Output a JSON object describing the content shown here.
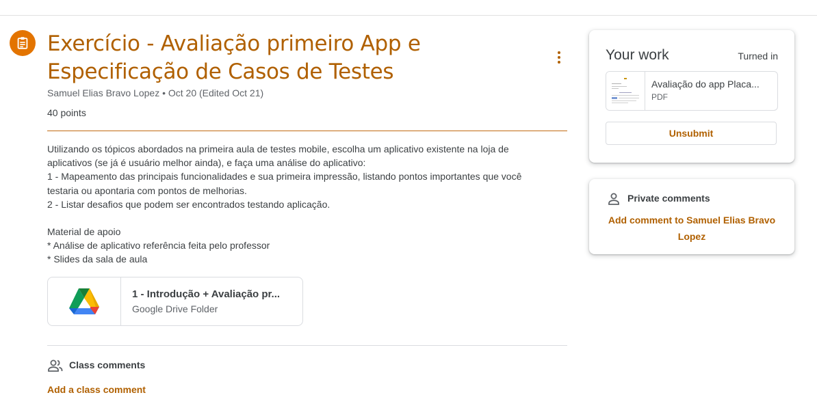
{
  "assignment": {
    "title": "Exercício - Avaliação primeiro App e Especificação de Casos de Testes",
    "author_date": "Samuel Elias Bravo Lopez • Oct 20 (Edited Oct 21)",
    "points": "40 points",
    "icon": "assignment-icon",
    "accent_color": "#e37400",
    "text_accent_color": "#b06000",
    "description": [
      "Utilizando os tópicos abordados na primeira aula de testes mobile, escolha um aplicativo existente na loja de",
      "aplicativos (se já é usuário melhor ainda), e faça uma análise do aplicativo:",
      "1 - Mapeamento das principais funcionalidades e sua primeira impressão, listando pontos importantes que você",
      "testaria ou apontaria com pontos de melhorias.",
      "2 - Listar desafios que podem ser encontrados testando aplicação.",
      "",
      "Material de apoio",
      "* Análise de aplicativo referência feita pelo professor",
      "* Slides da sala de aula"
    ],
    "attachment": {
      "title": "1 - Introdução + Avaliação pr...",
      "type": "Google Drive Folder",
      "icon": "google-drive-icon"
    }
  },
  "class_comments": {
    "label": "Class comments",
    "add": "Add a class comment",
    "icon": "people-icon"
  },
  "your_work": {
    "title": "Your work",
    "status": "Turned in",
    "file": {
      "name": "Avaliação do app Placa...",
      "type": "PDF"
    },
    "unsubmit": "Unsubmit"
  },
  "private_comments": {
    "label": "Private comments",
    "add": "Add comment to Samuel Elias Bravo Lopez",
    "icon": "person-icon"
  }
}
